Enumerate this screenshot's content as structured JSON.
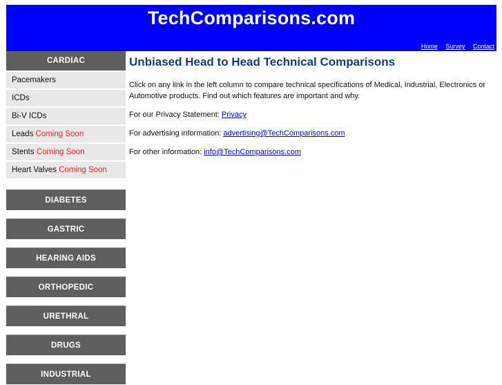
{
  "header": {
    "title": "TechComparisons.com",
    "bg_color": "#0000ff",
    "nav_links": [
      {
        "label": "Home"
      },
      {
        "label": "Survey"
      },
      {
        "label": "Contact"
      }
    ]
  },
  "sidebar": {
    "open_category": {
      "label": "CARDIAC",
      "items": [
        {
          "label": "Pacemakers",
          "badge": ""
        },
        {
          "label": "ICDs",
          "badge": ""
        },
        {
          "label": "Bi-V ICDs",
          "badge": ""
        },
        {
          "label": "Leads",
          "badge": "Coming Soon"
        },
        {
          "label": "Stents",
          "badge": "Coming Soon"
        },
        {
          "label": "Heart Valves",
          "badge": "Coming Soon"
        }
      ]
    },
    "categories": [
      {
        "label": "DIABETES"
      },
      {
        "label": "GASTRIC"
      },
      {
        "label": "HEARING AIDS"
      },
      {
        "label": "ORTHOPEDIC"
      },
      {
        "label": "URETHRAL"
      },
      {
        "label": "DRUGS"
      },
      {
        "label": "INDUSTRIAL"
      }
    ]
  },
  "main": {
    "heading": "Unbiased Head to Head Technical Comparisons",
    "intro": "Click on any link in the left column to compare technical specifications of Medical, Industrial, Electronics or Automotive products. Find out which features are important and why.",
    "privacy": {
      "prefix": "For our Privacy Statement: ",
      "link": "Privacy"
    },
    "advertising": {
      "prefix": "For advertising information: ",
      "link": "advertising@TechComparisons.com"
    },
    "other": {
      "prefix": "For other information: ",
      "link": "info@TechComparisons.com"
    }
  },
  "colors": {
    "heading": "#0d3d86",
    "sidebar_dark": "#5e5e5e",
    "sidebar_light": "#e8e8e8",
    "coming_soon": "#ee2222",
    "link": "#0000ee"
  }
}
